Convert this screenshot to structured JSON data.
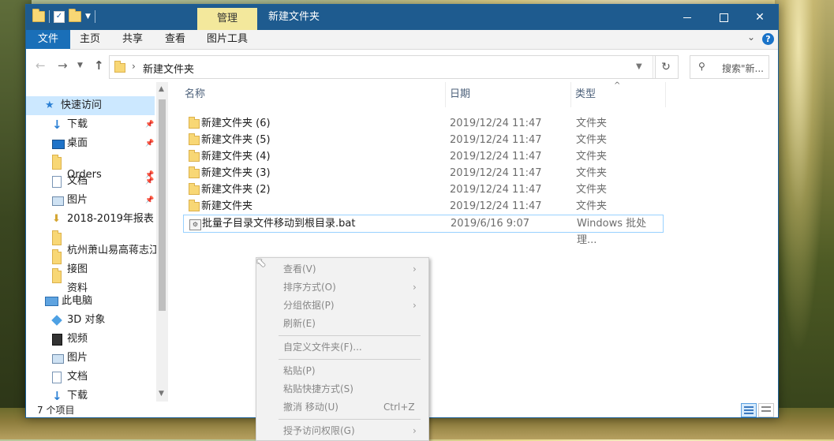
{
  "window": {
    "title": "新建文件夹",
    "contextual_tab": "管理",
    "buttons": {
      "minimize": "minimize",
      "maximize": "maximize",
      "close": "✕"
    }
  },
  "ribbon": {
    "tabs": [
      "文件",
      "主页",
      "共享",
      "查看",
      "图片工具"
    ],
    "help": "?"
  },
  "address": {
    "path": "新建文件夹",
    "search_placeholder": "搜索\"新..."
  },
  "nav_pane": {
    "quick_access": "快速访问",
    "items": [
      {
        "label": "下载",
        "icon": "download-arrow-icon",
        "pinned": true
      },
      {
        "label": "桌面",
        "icon": "desktop-icon",
        "pinned": true
      },
      {
        "label": "Orders",
        "icon": "folder-icon",
        "pinned": true
      },
      {
        "label": "文档",
        "icon": "document-icon",
        "pinned": true
      },
      {
        "label": "图片",
        "icon": "pictures-icon",
        "pinned": true
      },
      {
        "label": "2018-2019年报表",
        "icon": "folder-icon",
        "pinned": false
      },
      {
        "label": "杭州萧山易高蒋志江E",
        "icon": "folder-icon",
        "pinned": false
      },
      {
        "label": "接图",
        "icon": "folder-icon",
        "pinned": false
      },
      {
        "label": "资料",
        "icon": "folder-icon",
        "pinned": false
      }
    ],
    "this_pc": "此电脑",
    "pc_items": [
      {
        "label": "3D 对象",
        "icon": "3d-objects-icon"
      },
      {
        "label": "视频",
        "icon": "video-icon"
      },
      {
        "label": "图片",
        "icon": "pictures-icon"
      },
      {
        "label": "文档",
        "icon": "document-icon"
      },
      {
        "label": "下载",
        "icon": "download-arrow-icon"
      }
    ]
  },
  "file_list": {
    "columns": {
      "name": "名称",
      "date": "日期",
      "type": "类型"
    },
    "rows": [
      {
        "name": "新建文件夹 (6)",
        "date": "2019/12/24 11:47",
        "type": "文件夹"
      },
      {
        "name": "新建文件夹 (5)",
        "date": "2019/12/24 11:47",
        "type": "文件夹"
      },
      {
        "name": "新建文件夹 (4)",
        "date": "2019/12/24 11:47",
        "type": "文件夹"
      },
      {
        "name": "新建文件夹 (3)",
        "date": "2019/12/24 11:47",
        "type": "文件夹"
      },
      {
        "name": "新建文件夹 (2)",
        "date": "2019/12/24 11:47",
        "type": "文件夹"
      },
      {
        "name": "新建文件夹",
        "date": "2019/12/24 11:47",
        "type": "文件夹"
      },
      {
        "name": "批量子目录文件移动到根目录.bat",
        "date": "2019/6/16 9:07",
        "type": "Windows 批处理..."
      }
    ]
  },
  "status": {
    "item_count": "7 个项目"
  },
  "context_menu": {
    "view": "查看(V)",
    "sort": "排序方式(O)",
    "group": "分组依据(P)",
    "refresh": "刷新(E)",
    "customize": "自定义文件夹(F)...",
    "paste": "粘贴(P)",
    "paste_shortcut": "粘贴快捷方式(S)",
    "undo": "撤消 移动(U)",
    "undo_shortcut": "Ctrl+Z",
    "grant_access": "授予访问权限(G)"
  },
  "colors": {
    "titlebar": "#1e5b8f",
    "file_tab": "#1a6fb8",
    "manage_tab": "#f3e89c",
    "selected": "#cce8ff"
  }
}
